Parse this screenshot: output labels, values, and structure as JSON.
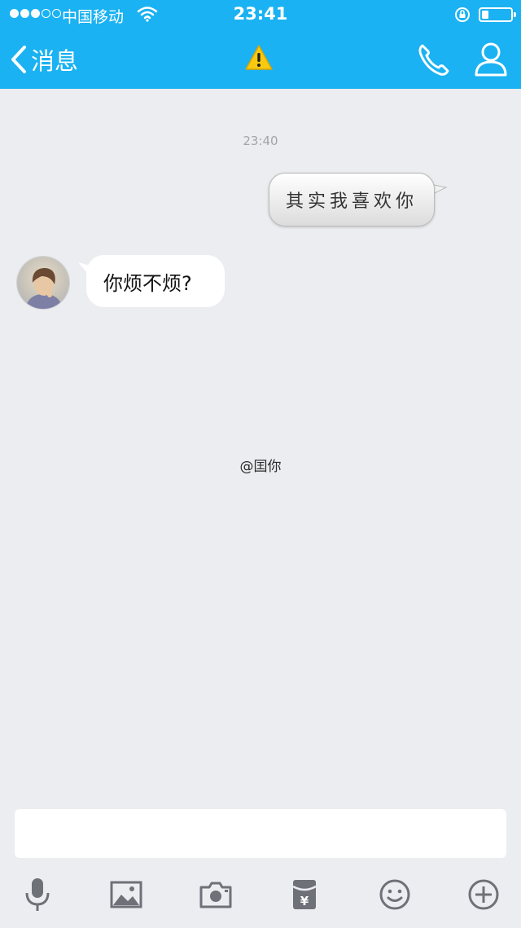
{
  "status_bar": {
    "carrier": "中国移动",
    "time": "23:41"
  },
  "nav": {
    "back_label": "消息"
  },
  "chat": {
    "timestamp": "23:40",
    "messages": [
      {
        "direction": "outgoing",
        "text": "其实我喜欢你"
      },
      {
        "direction": "incoming",
        "text": "你烦不烦?"
      }
    ]
  },
  "watermark": "@囯你",
  "composer": {
    "value": "",
    "placeholder": ""
  },
  "toolbar": {
    "icons": [
      "microphone-icon",
      "image-icon",
      "camera-icon",
      "red-packet-icon",
      "emoji-icon",
      "plus-circle-icon"
    ]
  },
  "theme": {
    "header_color": "#1ab2f2",
    "background": "#ecedf1",
    "icon_gray": "#6e7177"
  }
}
